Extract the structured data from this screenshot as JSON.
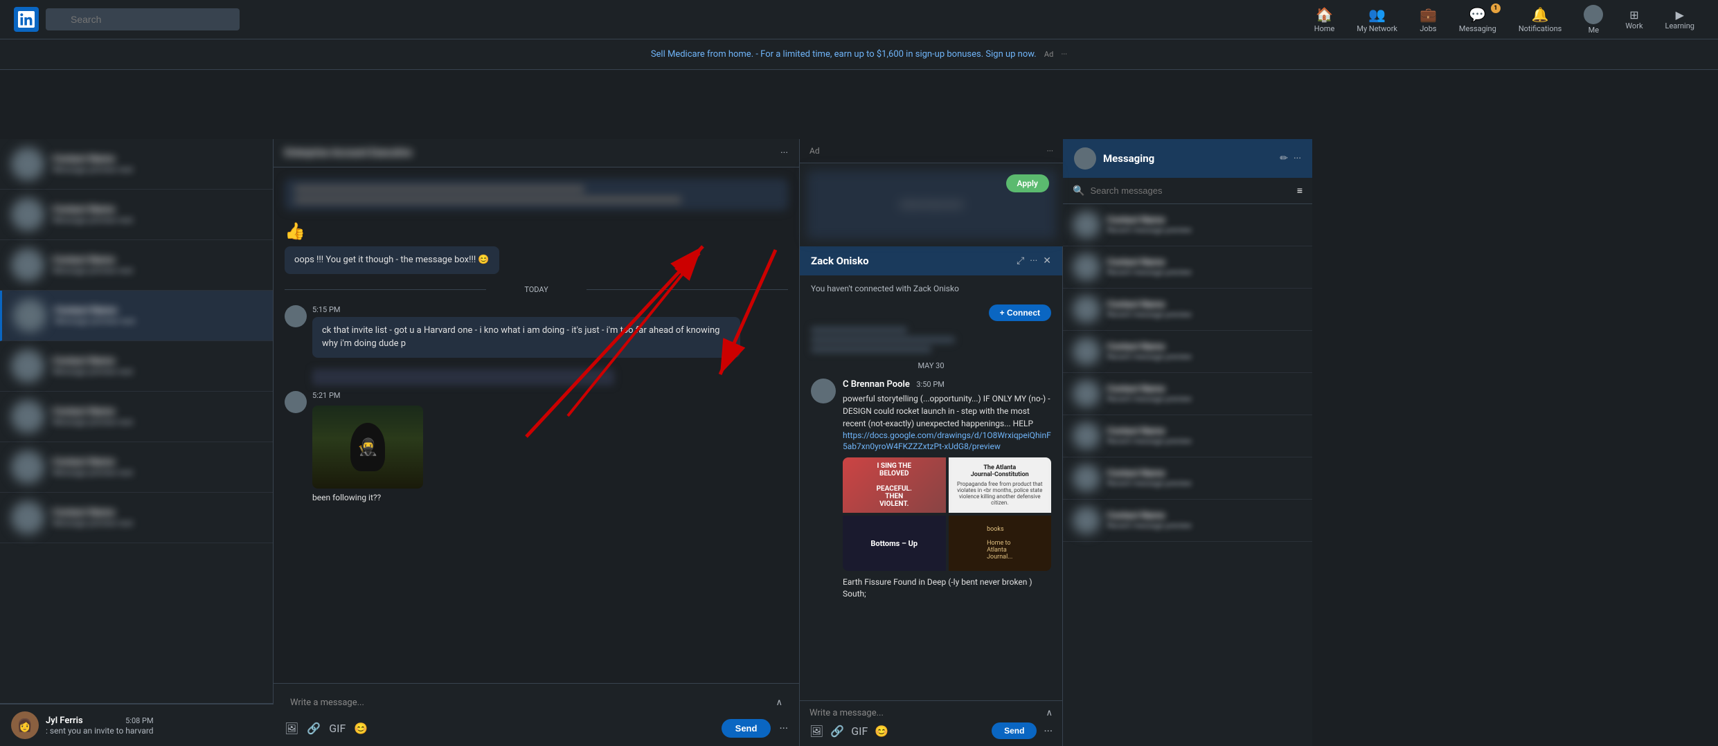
{
  "topNav": {
    "searchPlaceholder": "Search",
    "items": [
      {
        "label": "Me",
        "icon": "👤",
        "hasBadge": false
      },
      {
        "label": "Work",
        "icon": "⚙️",
        "hasBadge": false
      },
      {
        "label": "Learning",
        "icon": "📺",
        "hasBadge": false
      }
    ]
  },
  "promoBar": {
    "text": "Sell Medicare from home. - For a limited time, earn up to $1,600 in sign-up bonuses. Sign up now.",
    "adLabel": "Ad",
    "moreLabel": "···"
  },
  "chatPanel": {
    "header": {
      "name": "Enterprise Account Executive",
      "moreIcon": "···"
    },
    "messages": [
      {
        "emoji": "👍",
        "text": "oops !!! You get it though - the message box!!! 😊"
      }
    ],
    "todayLabel": "TODAY",
    "timeMessages": [
      {
        "time": "5:15 PM",
        "text": "ck that invite list - got u a Harvard one - i kno what i am doing - it's just - i'm too far ahead of knowing why i'm doing dude p"
      },
      {
        "time": "5:21 PM",
        "imageCaption": "been following it??",
        "hasImage": true
      }
    ],
    "writeMessagePlaceholder": "Write a message...",
    "toolbar": {
      "imageIcon": "🖼",
      "linkIcon": "🔗",
      "gifLabel": "GIF",
      "emojiIcon": "😊",
      "sendLabel": "Send",
      "moreIcon": "···"
    }
  },
  "zackPanel": {
    "header": {
      "name": "Zack Onisko",
      "expandIcon": "⤢",
      "moreIcon": "···",
      "closeIcon": "✕",
      "connectIcon": "+"
    },
    "notConnected": "You haven't connected with Zack Onisko",
    "may30Label": "MAY 30",
    "message": {
      "sender": "C Brennan Poole",
      "time": "3:50 PM",
      "text": "powerful storytelling (...opportunity...) IF ONLY MY (no-) - DESIGN could rocket launch in - step with the most recent (not-exactly) unexpected happenings... HELP",
      "link": "https://docs.google.com/drawings/d/1O8WrxiqpeiQhinF5ab7xn0yroW4FKZZZxtzPt-xUdG8/preview"
    },
    "imageGrid": [
      {
        "label": "I SING THE BELOVED PEACEFUL. THEN VIOLENT.",
        "style": "red"
      },
      {
        "label": "The Atlanta Journal-Constitution",
        "style": "white"
      },
      {
        "label": "Bottoms - Up",
        "style": "dark"
      },
      {
        "label": "books",
        "style": "brown"
      }
    ],
    "earthFissure": "Earth Fissure Found in Deep (-ly bent never broken ) South;",
    "writeMessagePlaceholder": "Write a message...",
    "toolbar": {
      "imageIcon": "🖼",
      "linkIcon": "🔗",
      "gifLabel": "GIF",
      "emojiIcon": "😊",
      "sendLabel": "Send",
      "moreIcon": "···"
    }
  },
  "messagingPanel": {
    "title": "Messaging",
    "editIcon": "✏",
    "moreIcon": "···",
    "searchPlaceholder": "Search messages",
    "filterIcon": "≡",
    "listItems": [
      {
        "name": "Contact 1",
        "preview": "message preview"
      },
      {
        "name": "Contact 2",
        "preview": "message preview"
      },
      {
        "name": "Contact 3",
        "preview": "message preview"
      },
      {
        "name": "Contact 4",
        "preview": "message preview"
      },
      {
        "name": "Contact 5",
        "preview": "message preview"
      },
      {
        "name": "Contact 6",
        "preview": "message preview"
      },
      {
        "name": "Contact 7",
        "preview": "message preview"
      },
      {
        "name": "Contact 8",
        "preview": "message preview"
      }
    ]
  },
  "jylFerris": {
    "name": "Jyl Ferris",
    "time": "5:08 PM",
    "preview": ": sent you an invite to harvard"
  },
  "arrows": {
    "color": "#cc0000",
    "paths": [
      {
        "from": "chat-message-box",
        "to": "zack-header"
      },
      {
        "from": "zack-header",
        "to": "cbrennan-message"
      }
    ]
  }
}
